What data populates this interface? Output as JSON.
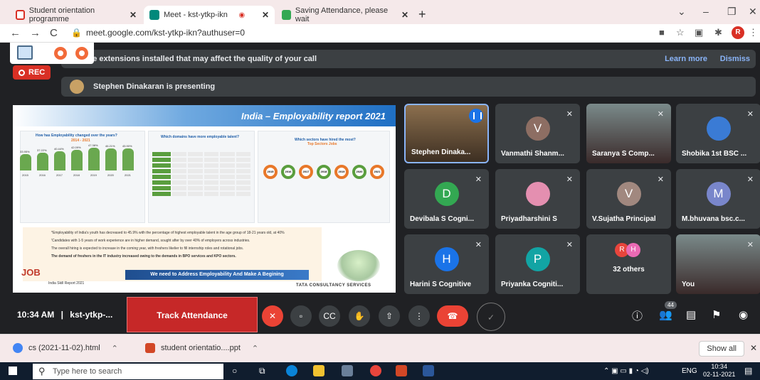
{
  "tabs": [
    {
      "label": "Student orientation programme",
      "color": "#d93025"
    },
    {
      "label": "Meet - kst-ytkp-ikn",
      "color": "#00897b"
    },
    {
      "label": "Saving Attendance, please wait",
      "color": "#34a853"
    }
  ],
  "url": "meet.google.com/kst-ytkp-ikn?authuser=0",
  "profile_initial": "R",
  "banner": {
    "text": "ave extensions installed that may affect the quality of your call",
    "learn_more": "Learn more",
    "dismiss": "Dismiss"
  },
  "rec_label": "REC",
  "presenting_text": "Stephen Dinakaran is presenting",
  "slide": {
    "title": "India – Employability report 2021",
    "panel1_title": "How has Employability changed over the years?",
    "panel1_sub": "2014 - 2021",
    "panel2_title": "Which domains have more employable talent?",
    "panel3_title": "Which sectors have hired the most?",
    "panel3_sub": "Top Sectors Jobs",
    "bar_values": [
      "33.95%",
      "37.22%",
      "40.44%",
      "42.09%",
      "47.38%",
      "46.21%",
      "45.90%"
    ],
    "years": [
      "2015",
      "2016",
      "2017",
      "2018",
      "2019",
      "2020",
      "2021"
    ],
    "bullets": [
      "*Employability of India's youth has decreased to 45.9% with the percentage of highest employable talent in the age group of 18-21 years old, at 40%",
      "'Candidates with 1-5 years of work experience are in higher demand, sought after by over 40% of employers across industries.",
      "The overall hiring is expected to increase in the coming year, with freshers likelier to fill internship roles and rotational jobs.",
      "The demand of freshers in the IT industry increased owing to the demands in BPO services and KPO sectors."
    ],
    "job_label": "JOB",
    "india_report": "India Skill Report 2021",
    "banner": "We need to Address Employability And Make A Begining",
    "tata": "TATA CONSULTANCY SERVICES"
  },
  "participants": [
    {
      "name": "Stephen Dinaka...",
      "type": "video",
      "speaking": true
    },
    {
      "name": "Vanmathi Shanm...",
      "initial": "V",
      "color": "#8d6e63"
    },
    {
      "name": "Saranya S Comp...",
      "type": "video"
    },
    {
      "name": "Shobika 1st BSC ...",
      "type": "image"
    },
    {
      "name": "Devibala S Cogni...",
      "initial": "D",
      "color": "#33a852"
    },
    {
      "name": "Priyadharshini S",
      "type": "image"
    },
    {
      "name": "V.Sujatha Principal",
      "initial": "V",
      "color": "#a1887f"
    },
    {
      "name": "M.bhuvana bsc.c...",
      "initial": "M",
      "color": "#7986cb"
    },
    {
      "name": "Harini S Cognitive",
      "initial": "H",
      "color": "#1a73e8"
    },
    {
      "name": "Priyanka Cogniti...",
      "initial": "P",
      "color": "#12a4a4"
    },
    {
      "name": "32 others",
      "type": "others",
      "a1": "R",
      "a2": "H"
    },
    {
      "name": "You",
      "type": "video"
    }
  ],
  "controls": {
    "time": "10:34 AM",
    "meeting_code": "kst-ytkp-...",
    "track_attendance": "Track Attendance",
    "participant_count": "44"
  },
  "downloads": [
    {
      "name": "cs (2021-11-02).html"
    },
    {
      "name": "student orientatio....ppt"
    }
  ],
  "show_all": "Show all",
  "taskbar": {
    "search_placeholder": "Type here to search",
    "lang": "ENG",
    "time": "10:34",
    "date": "02-11-2021"
  }
}
